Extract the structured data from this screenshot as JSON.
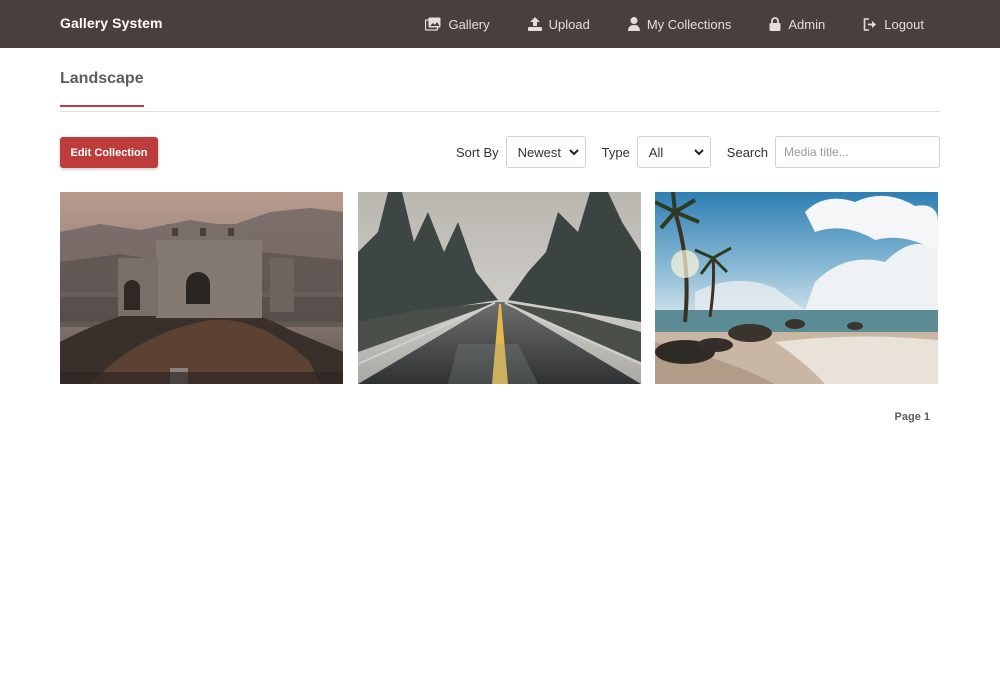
{
  "app": {
    "title": "Gallery System"
  },
  "nav": {
    "items": [
      {
        "label": "Gallery",
        "icon": "images-icon"
      },
      {
        "label": "Upload",
        "icon": "upload-icon"
      },
      {
        "label": "My Collections",
        "icon": "user-icon"
      },
      {
        "label": "Admin",
        "icon": "lock-icon"
      },
      {
        "label": "Logout",
        "icon": "logout-icon"
      }
    ]
  },
  "collection": {
    "title": "Landscape"
  },
  "toolbar": {
    "edit_label": "Edit Collection",
    "sort_label": "Sort By",
    "sort_value": "Newest",
    "type_label": "Type",
    "type_value": "All",
    "search_label": "Search",
    "search_placeholder": "Media title..."
  },
  "media": [
    {
      "subject": "ruined stone tower on hill at dusk",
      "icon": "photo-ruins"
    },
    {
      "subject": "wet road through misty pine forest",
      "icon": "photo-road"
    },
    {
      "subject": "rocky beach with palm trees and clouds",
      "icon": "photo-beach"
    }
  ],
  "pagination": {
    "label": "Page 1"
  },
  "colors": {
    "navbar": "#4a3f3c",
    "accent": "#bd3d3d"
  }
}
